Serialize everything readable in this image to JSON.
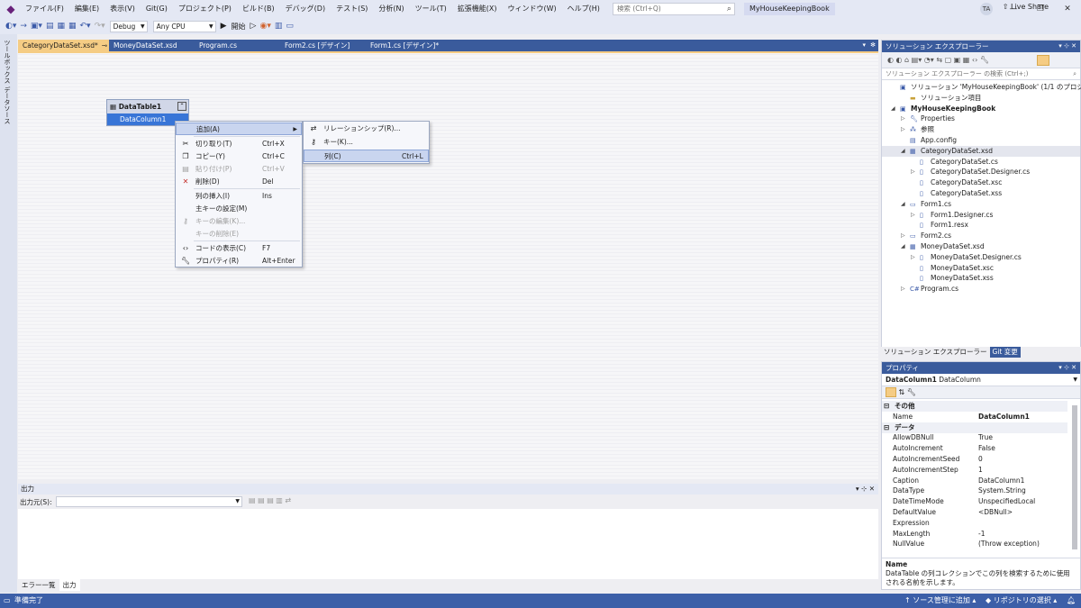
{
  "menubar": {
    "items": [
      "ファイル(F)",
      "編集(E)",
      "表示(V)",
      "Git(G)",
      "プロジェクト(P)",
      "ビルド(B)",
      "デバッグ(D)",
      "テスト(S)",
      "分析(N)",
      "ツール(T)",
      "拡張機能(X)",
      "ウィンドウ(W)",
      "ヘルプ(H)"
    ],
    "search_placeholder": "検索 (Ctrl+Q)",
    "solution_name": "MyHouseKeepingBook",
    "avatar": "TA"
  },
  "toolbar": {
    "config": "Debug",
    "platform": "Any CPU",
    "start_label": "開始",
    "live_share": "Live Share"
  },
  "left_strip": {
    "toolbox": "ツールボックス",
    "datasources": "データソース"
  },
  "doc_tabs": [
    {
      "label": "CategoryDataSet.xsd*",
      "active": true
    },
    {
      "label": "MoneyDataSet.xsd",
      "active": false
    },
    {
      "label": "Program.cs",
      "active": false
    },
    {
      "label": "Form2.cs [デザイン]",
      "active": false
    },
    {
      "label": "Form1.cs [デザイン]*",
      "active": false
    }
  ],
  "designer": {
    "table_name": "DataTable1",
    "column_name": "DataColumn1"
  },
  "context_menu": {
    "items": [
      {
        "label": "追加(A)",
        "shortcut": "",
        "disabled": false,
        "highlight": true,
        "icon": ""
      },
      {
        "label": "切り取り(T)",
        "shortcut": "Ctrl+X",
        "disabled": false,
        "icon": "scissors-icon"
      },
      {
        "label": "コピー(Y)",
        "shortcut": "Ctrl+C",
        "disabled": false,
        "icon": "copy-icon"
      },
      {
        "label": "貼り付け(P)",
        "shortcut": "Ctrl+V",
        "disabled": true,
        "icon": "paste-icon"
      },
      {
        "label": "削除(D)",
        "shortcut": "Del",
        "disabled": false,
        "icon": "delete-icon"
      },
      {
        "label": "列の挿入(I)",
        "shortcut": "Ins",
        "disabled": false,
        "icon": ""
      },
      {
        "label": "主キーの設定(M)",
        "shortcut": "",
        "disabled": false,
        "icon": ""
      },
      {
        "label": "キーの編集(K)...",
        "shortcut": "",
        "disabled": true,
        "icon": "key-icon"
      },
      {
        "label": "キーの削除(E)",
        "shortcut": "",
        "disabled": true,
        "icon": ""
      },
      {
        "label": "コードの表示(C)",
        "shortcut": "F7",
        "disabled": false,
        "icon": "code-icon"
      },
      {
        "label": "プロパティ(R)",
        "shortcut": "Alt+Enter",
        "disabled": false,
        "icon": "wrench-icon"
      }
    ],
    "submenu": [
      {
        "label": "リレーションシップ(R)...",
        "shortcut": ""
      },
      {
        "label": "キー(K)...",
        "shortcut": ""
      },
      {
        "label": "列(C)",
        "shortcut": "Ctrl+L"
      }
    ]
  },
  "output": {
    "title": "出力",
    "source_label": "出力元(S):",
    "tabs": [
      "エラー一覧",
      "出力"
    ]
  },
  "status": {
    "ready": "準備完了",
    "source_control": "ソース管理に追加",
    "repository": "リポジトリの選択"
  },
  "solution_explorer": {
    "title": "ソリューション エクスプローラー",
    "search_placeholder": "ソリューション エクスプローラー の検索 (Ctrl+;)",
    "nodes": [
      {
        "label": "ソリューション 'MyHouseKeepingBook' (1/1 のプロジェクト)",
        "depth": 0,
        "expander": "",
        "icon": "solution-icon"
      },
      {
        "label": "ソリューション項目",
        "depth": 1,
        "expander": "",
        "icon": "folder-icon"
      },
      {
        "label": "MyHouseKeepingBook",
        "depth": 0,
        "expander": "◢",
        "icon": "project-icon",
        "bold": true
      },
      {
        "label": "Properties",
        "depth": 1,
        "expander": "▷",
        "icon": "wrench-icon"
      },
      {
        "label": "参照",
        "depth": 1,
        "expander": "▷",
        "icon": "references-icon"
      },
      {
        "label": "App.config",
        "depth": 1,
        "expander": "",
        "icon": "config-icon"
      },
      {
        "label": "CategoryDataSet.xsd",
        "depth": 1,
        "expander": "◢",
        "icon": "dataset-icon",
        "selected": true
      },
      {
        "label": "CategoryDataSet.cs",
        "depth": 2,
        "expander": "",
        "icon": "file-icon"
      },
      {
        "label": "CategoryDataSet.Designer.cs",
        "depth": 2,
        "expander": "▷",
        "icon": "file-icon"
      },
      {
        "label": "CategoryDataSet.xsc",
        "depth": 2,
        "expander": "",
        "icon": "file-icon"
      },
      {
        "label": "CategoryDataSet.xss",
        "depth": 2,
        "expander": "",
        "icon": "file-icon"
      },
      {
        "label": "Form1.cs",
        "depth": 1,
        "expander": "◢",
        "icon": "form-icon"
      },
      {
        "label": "Form1.Designer.cs",
        "depth": 2,
        "expander": "▷",
        "icon": "file-icon"
      },
      {
        "label": "Form1.resx",
        "depth": 2,
        "expander": "",
        "icon": "file-icon"
      },
      {
        "label": "Form2.cs",
        "depth": 1,
        "expander": "▷",
        "icon": "form-icon"
      },
      {
        "label": "MoneyDataSet.xsd",
        "depth": 1,
        "expander": "◢",
        "icon": "dataset-icon"
      },
      {
        "label": "MoneyDataSet.Designer.cs",
        "depth": 2,
        "expander": "▷",
        "icon": "file-icon"
      },
      {
        "label": "MoneyDataSet.xsc",
        "depth": 2,
        "expander": "",
        "icon": "file-icon"
      },
      {
        "label": "MoneyDataSet.xss",
        "depth": 2,
        "expander": "",
        "icon": "file-icon"
      },
      {
        "label": "Program.cs",
        "depth": 1,
        "expander": "▷",
        "icon": "csharp-icon"
      }
    ],
    "tabs": [
      "ソリューション エクスプローラー",
      "Git 変更"
    ]
  },
  "properties": {
    "title": "プロパティ",
    "object_name": "DataColumn1",
    "object_type": "DataColumn",
    "rows": [
      {
        "name": "その他",
        "value": "",
        "category": true
      },
      {
        "name": "Name",
        "value": "DataColumn1",
        "bold": true
      },
      {
        "name": "データ",
        "value": "",
        "category": true
      },
      {
        "name": "AllowDBNull",
        "value": "True"
      },
      {
        "name": "AutoIncrement",
        "value": "False"
      },
      {
        "name": "AutoIncrementSeed",
        "value": "0"
      },
      {
        "name": "AutoIncrementStep",
        "value": "1"
      },
      {
        "name": "Caption",
        "value": "DataColumn1"
      },
      {
        "name": "DataType",
        "value": "System.String"
      },
      {
        "name": "DateTimeMode",
        "value": "UnspecifiedLocal"
      },
      {
        "name": "DefaultValue",
        "value": "<DBNull>"
      },
      {
        "name": "Expression",
        "value": ""
      },
      {
        "name": "MaxLength",
        "value": "-1"
      },
      {
        "name": "NullValue",
        "value": "(Throw exception)"
      }
    ],
    "desc_name": "Name",
    "desc_text": "DataTable の列コレクションでこの列を検索するために使用される名前を示します。"
  }
}
